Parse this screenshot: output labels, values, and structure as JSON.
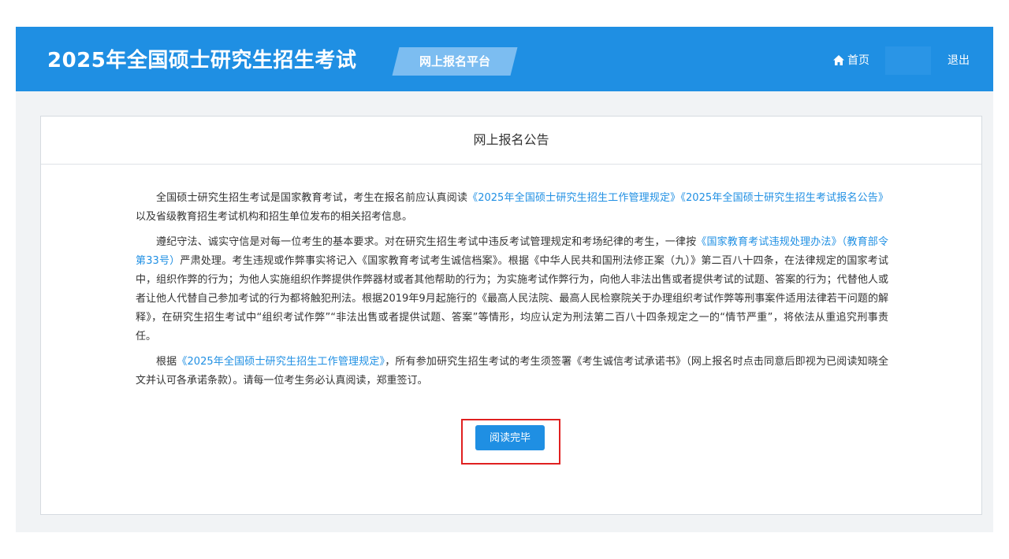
{
  "header": {
    "title": "2025年全国硕士研究生招生考试",
    "platform_tag": "网上报名平台",
    "nav_home": "首页",
    "nav_home_icon": "home-icon",
    "nav_logout": "退出",
    "color": "#1f8fe3"
  },
  "panel": {
    "title": "网上报名公告"
  },
  "notice": {
    "p1_a": "全国硕士研究生招生考试是国家教育考试，考生在报名前应认真阅读",
    "p1_link1": "《2025年全国硕士研究生招生工作管理规定》",
    "p1_link2": "《2025年全国硕士研究生招生考试报名公告》",
    "p1_b": "以及省级教育招生考试机构和招生单位发布的相关招考信息。",
    "p2_a": "遵纪守法、诚实守信是对每一位考生的基本要求。对在研究生招生考试中违反考试管理规定和考场纪律的考生，一律按",
    "p2_link": "《国家教育考试违规处理办法》（教育部令第33号）",
    "p2_b": "严肃处理。考生违规或作弊事实将记入《国家教育考试考生诚信档案》。根据《中华人民共和国刑法修正案（九）》第二百八十四条，在法律规定的国家考试中，组织作弊的行为；为他人实施组织作弊提供作弊器材或者其他帮助的行为；为实施考试作弊行为，向他人非法出售或者提供考试的试题、答案的行为；代替他人或者让他人代替自己参加考试的行为都将触犯刑法。根据2019年9月起施行的《最高人民法院、最高人民检察院关于办理组织考试作弊等刑事案件适用法律若干问题的解释》，在研究生招生考试中“组织考试作弊”“非法出售或者提供试题、答案”等情形，均应认定为刑法第二百八十四条规定之一的“情节严重”，将依法从重追究刑事责任。",
    "p3_a": "根据",
    "p3_link": "《2025年全国硕士研究生招生工作管理规定》",
    "p3_b": "，所有参加研究生招生考试的考生须签署《考生诚信考试承诺书》（网上报名时点击同意后即视为已阅读知晓全文并认可各承诺条款）。请每一位考生务必认真阅读，郑重签订。"
  },
  "read_button": "阅读完毕",
  "colors": {
    "link": "#1f8fe3",
    "highlight": "#e02020"
  }
}
